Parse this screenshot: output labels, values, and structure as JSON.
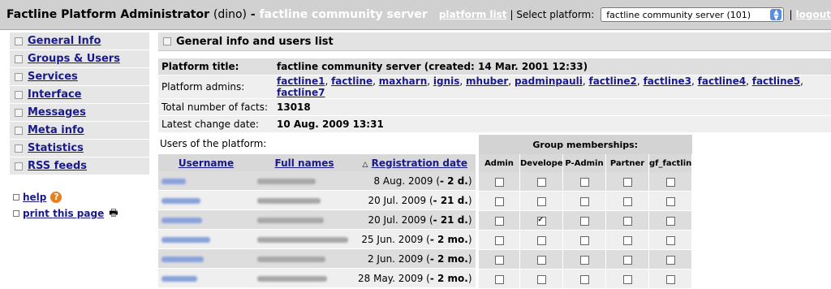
{
  "header": {
    "app_title": "Factline Platform Administrator",
    "user": "(dino)",
    "separator": "-",
    "server_name": "factline community server",
    "platform_list_label": "platform list",
    "select_label": "| Select platform:",
    "selected_platform": "factline community server (101)",
    "logout_label": "logout"
  },
  "sidebar": {
    "items": [
      {
        "label": "General Info"
      },
      {
        "label": "Groups & Users"
      },
      {
        "label": "Services"
      },
      {
        "label": "Interface"
      },
      {
        "label": "Messages"
      },
      {
        "label": "Meta info"
      },
      {
        "label": "Statistics"
      },
      {
        "label": "RSS feeds"
      }
    ],
    "help_label": "help",
    "print_label": "print this page"
  },
  "main": {
    "section_title": "General info and users list",
    "info": {
      "platform_title_label": "Platform title:",
      "platform_title_value": "factline community server (created: 14 Mar. 2001 12:33)",
      "admins_label": "Platform admins:",
      "admins": [
        "factline1",
        "factline",
        "maxharn",
        "ignis",
        "mhuber",
        "padminpauli",
        "factline2",
        "factline3",
        "factline4",
        "factline5",
        "factline7"
      ],
      "facts_label": "Total number of facts:",
      "facts_value": "13018",
      "change_label": "Latest change date:",
      "change_value": "10 Aug. 2009 13:31"
    },
    "users_caption": "Users of the platform:",
    "columns": {
      "username": "Username",
      "fullnames": "Full names",
      "registration": "Registration date",
      "sort_indicator": "△"
    },
    "groups": {
      "title": "Group memberships:",
      "columns": [
        "Admin",
        "Developer",
        "P-Admin",
        "Partner",
        "gf_factline"
      ]
    },
    "users": [
      {
        "date": "8 Aug. 2009",
        "ago": "- 2 d.",
        "groups": [
          false,
          false,
          false,
          false,
          false
        ]
      },
      {
        "date": "20 Jul. 2009",
        "ago": "- 21 d.",
        "groups": [
          false,
          false,
          false,
          false,
          false
        ]
      },
      {
        "date": "20 Jul. 2009",
        "ago": "- 21 d.",
        "groups": [
          false,
          true,
          false,
          false,
          false
        ]
      },
      {
        "date": "25 Jun. 2009",
        "ago": "- 2 mo.",
        "groups": [
          false,
          false,
          false,
          false,
          false
        ]
      },
      {
        "date": "2 Jun. 2009",
        "ago": "- 2 mo.",
        "groups": [
          false,
          false,
          false,
          false,
          false
        ]
      },
      {
        "date": "28 May. 2009",
        "ago": "- 2 mo.",
        "groups": [
          false,
          false,
          false,
          false,
          false
        ]
      }
    ]
  }
}
